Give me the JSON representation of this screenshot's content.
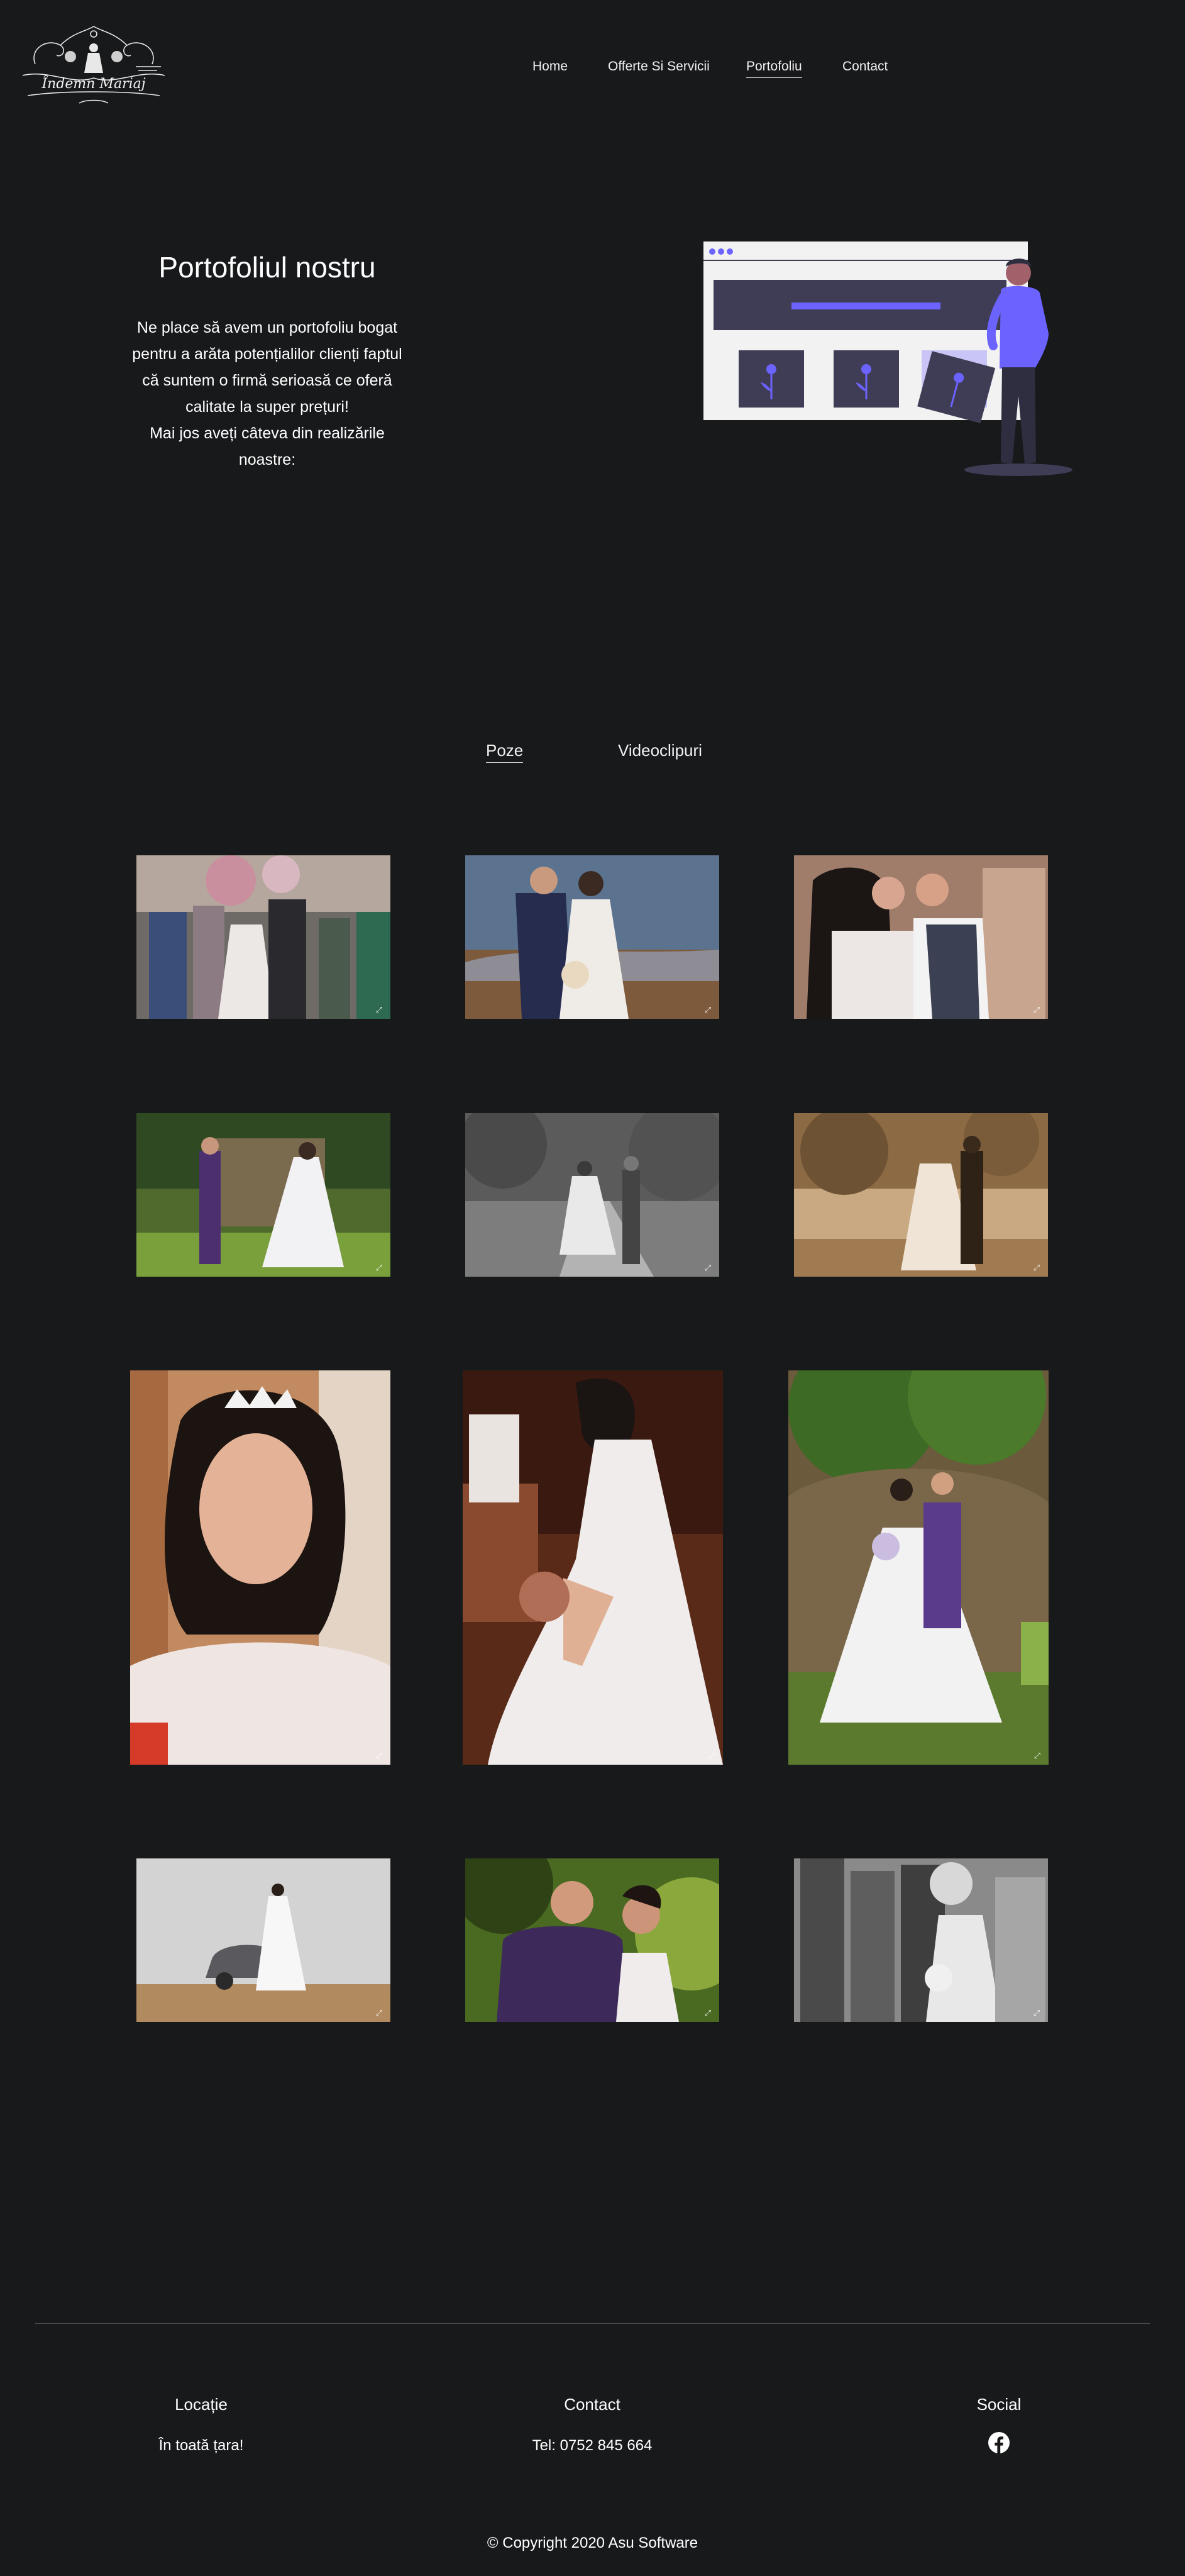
{
  "header": {
    "logo": {
      "name_text": "Îndemn Mariaj",
      "icon": "ornamental-couple-logo"
    },
    "nav": [
      {
        "label": "Home",
        "active": false
      },
      {
        "label": "Offerte Si Servicii",
        "active": false
      },
      {
        "label": "Portofoliu",
        "active": true
      },
      {
        "label": "Contact",
        "active": false
      }
    ]
  },
  "hero": {
    "title": "Portofoliul nostru",
    "paragraph_lines": [
      "Ne place să avem un portofoliu bogat",
      "pentru a arăta potențialilor clienți faptul",
      "că suntem o firmă serioasă ce oferă",
      "calitate la super prețuri!",
      "Mai jos aveți câteva din realizările",
      "noastre:"
    ],
    "illustration": "portfolio-website-illustration",
    "accent_color": "#6c63ff"
  },
  "tabs": [
    {
      "label": "Poze",
      "active": true
    },
    {
      "label": "Videoclipuri",
      "active": false
    }
  ],
  "gallery": {
    "photos": [
      {
        "subject": "wedding-guests-celebration-photo"
      },
      {
        "subject": "couple-kiss-hillside-photo"
      },
      {
        "subject": "couple-kiss-indoor-photo"
      },
      {
        "subject": "couple-holding-hands-park-photo"
      },
      {
        "subject": "couple-walking-path-bw-photo"
      },
      {
        "subject": "couple-sepia-garden-photo"
      },
      {
        "subject": "bride-portrait-tiara-photo"
      },
      {
        "subject": "bride-shoe-fitting-photo"
      },
      {
        "subject": "couple-under-tree-photo"
      },
      {
        "subject": "bride-by-convertible-photo"
      },
      {
        "subject": "couple-laughing-photo"
      },
      {
        "subject": "wedding-party-bw-photo"
      }
    ],
    "zoom_icon": "expand-icon"
  },
  "footer": {
    "location": {
      "heading": "Locație",
      "value": "În toată țara!"
    },
    "contact": {
      "heading": "Contact",
      "value": "Tel: 0752 845 664"
    },
    "social": {
      "heading": "Social",
      "icon": "facebook-icon"
    },
    "copyright": "© Copyright 2020 Asu Software"
  }
}
